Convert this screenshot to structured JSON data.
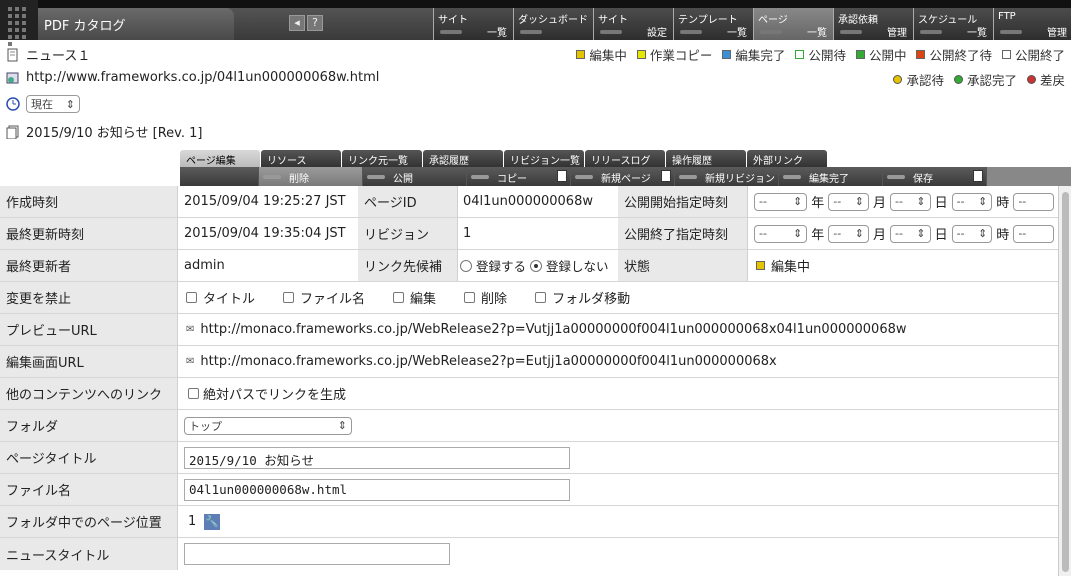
{
  "app": {
    "title": "PDF カタログ"
  },
  "top_nav": [
    {
      "l1": "サイト",
      "l2": "一覧"
    },
    {
      "l1": "ダッシュボード",
      "l2": ""
    },
    {
      "l1": "サイト",
      "l2": "設定"
    },
    {
      "l1": "テンプレート",
      "l2": "一覧"
    },
    {
      "l1": "ページ",
      "l2": "一覧"
    },
    {
      "l1": "承認依頼",
      "l2": "管理"
    },
    {
      "l1": "スケジュール",
      "l2": "一覧"
    },
    {
      "l1": "FTP",
      "l2": "管理"
    }
  ],
  "header": {
    "page_name": "ニュース１",
    "url": "http://www.frameworks.co.jp/04l1un000000068w.html",
    "time_select": "現在",
    "revision": "2015/9/10 お知らせ [Rev. 1]"
  },
  "legend_status": [
    {
      "label": "編集中",
      "color": "#e6c300"
    },
    {
      "label": "作業コピー",
      "color": "#e6e600"
    },
    {
      "label": "編集完了",
      "color": "#3a8fd6"
    },
    {
      "label": "公開待",
      "color": "#ffffff"
    },
    {
      "label": "公開中",
      "color": "#33aa33"
    },
    {
      "label": "公開終了待",
      "color": "#dd4411"
    },
    {
      "label": "公開終了",
      "color": "#ffffff"
    }
  ],
  "legend_approval": [
    {
      "label": "承認待",
      "color": "#e6c300"
    },
    {
      "label": "承認完了",
      "color": "#33aa33"
    },
    {
      "label": "差戻",
      "color": "#cc3333"
    }
  ],
  "tabs": [
    "ページ編集",
    "リソース",
    "リンク元一覧",
    "承認履歴",
    "リビジョン一覧",
    "リリースログ",
    "操作履歴",
    "外部リンク"
  ],
  "actions": [
    "削除",
    "公開",
    "コピー",
    "新規ページ",
    "新規リビジョン",
    "編集完了",
    "保存"
  ],
  "rows": {
    "created_label": "作成時刻",
    "created_value": "2015/09/04 19:25:27 JST",
    "page_id_label": "ページID",
    "page_id_value": "04l1un000000068w",
    "pub_start_label": "公開開始指定時刻",
    "updated_label": "最終更新時刻",
    "updated_value": "2015/09/04 19:35:04 JST",
    "revision_label": "リビジョン",
    "revision_value": "1",
    "pub_end_label": "公開終了指定時刻",
    "updater_label": "最終更新者",
    "updater_value": "admin",
    "link_label": "リンク先候補",
    "link_opt_register": "登録する",
    "link_opt_noregister": "登録しない",
    "state_label": "状態",
    "state_value": "編集中",
    "lock_label": "変更を禁止",
    "lock_opts": [
      "タイトル",
      "ファイル名",
      "編集",
      "削除",
      "フォルダ移動"
    ],
    "preview_label": "プレビューURL",
    "preview_value": "http://monaco.frameworks.co.jp/WebRelease2?p=Vutjj1a00000000f004l1un000000068x04l1un000000068w",
    "edit_label": "編集画面URL",
    "edit_value": "http://monaco.frameworks.co.jp/WebRelease2?p=Eutjj1a00000000f004l1un000000068x",
    "other_link_label": "他のコンテンツへのリンク",
    "other_link_opt": "絶対パスでリンクを生成",
    "folder_label": "フォルダ",
    "folder_value": "トップ",
    "title_label": "ページタイトル",
    "title_value": "2015/9/10 お知らせ",
    "filename_label": "ファイル名",
    "filename_value": "04l1un000000068w.html",
    "position_label": "フォルダ中でのページ位置",
    "position_value": "1",
    "news_title_label": "ニュースタイトル",
    "news_title_value": ""
  },
  "date_units": [
    "年",
    "月",
    "日",
    "時"
  ],
  "date_placeholder": "--"
}
